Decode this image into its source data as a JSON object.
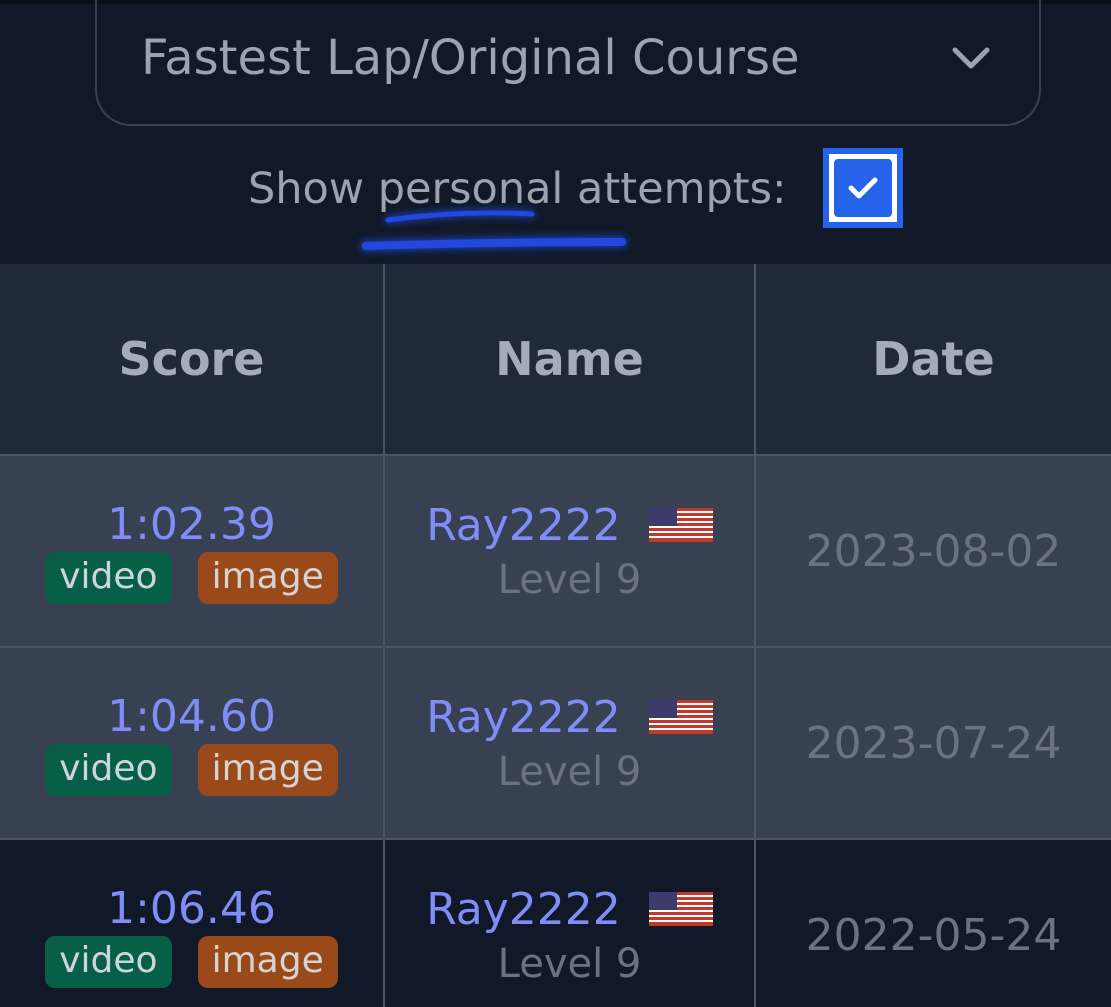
{
  "filter": {
    "selected": "Fastest Lap/Original Course"
  },
  "personal": {
    "label": "Show personal attempts:",
    "checked": true
  },
  "table": {
    "headers": [
      "Score",
      "Name",
      "Date"
    ],
    "rows": [
      {
        "score": "1:02.39",
        "tags": [
          "video",
          "image"
        ],
        "name": "Ray2222",
        "level": "Level 9",
        "date": "2023-08-02",
        "country": "US"
      },
      {
        "score": "1:04.60",
        "tags": [
          "video",
          "image"
        ],
        "name": "Ray2222",
        "level": "Level 9",
        "date": "2023-07-24",
        "country": "US"
      },
      {
        "score": "1:06.46",
        "tags": [
          "video",
          "image"
        ],
        "name": "Ray2222",
        "level": "Level 9",
        "date": "2022-05-24",
        "country": "US"
      }
    ]
  },
  "icons": {
    "dropdown": "chevron-down-icon",
    "check": "check-icon",
    "flag": "us-flag-icon"
  },
  "colors": {
    "background": "#111827",
    "header": "#1f2937",
    "highlight_row": "#374151",
    "accent": "#818cf8",
    "checkbox": "#2563eb",
    "video_tag": "#065f46",
    "image_tag": "#9a4a1a"
  }
}
